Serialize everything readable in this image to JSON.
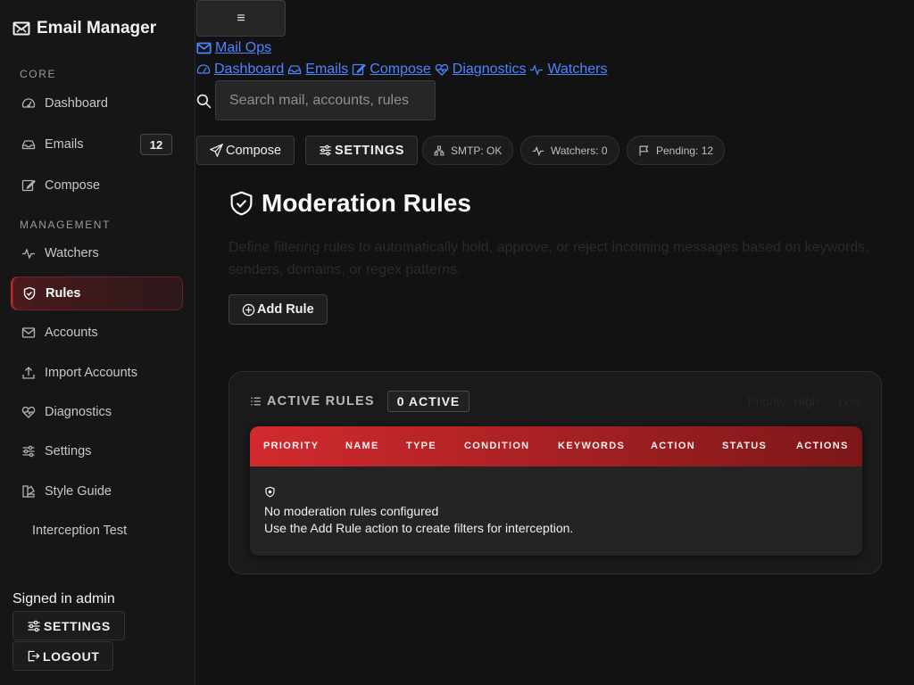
{
  "sidebar": {
    "brand": "Email Manager",
    "sections": {
      "core": "CORE",
      "management": "MANAGEMENT"
    },
    "items": [
      {
        "label": "Dashboard",
        "icon": "gauge-icon"
      },
      {
        "label": "Emails",
        "icon": "inbox-icon",
        "badge": "12"
      },
      {
        "label": "Compose",
        "icon": "pencil-square-icon"
      },
      {
        "label": "Watchers",
        "icon": "activity-icon"
      },
      {
        "label": "Rules",
        "icon": "shield-check-icon",
        "active": true
      },
      {
        "label": "Accounts",
        "icon": "envelope-paper-icon"
      },
      {
        "label": "Import Accounts",
        "icon": "upload-icon"
      },
      {
        "label": "Diagnostics",
        "icon": "heart-pulse-icon"
      },
      {
        "label": "Settings",
        "icon": "sliders-icon"
      },
      {
        "label": "Style Guide",
        "icon": "palette-icon"
      },
      {
        "label": "Interception Test"
      }
    ],
    "signed_in": "Signed in admin",
    "settings_label": "SETTINGS",
    "logout_label": "LOGOUT"
  },
  "topbar": {
    "menu_toggle": "≡",
    "brand_link": "Mail Ops",
    "nav_links": [
      "Dashboard",
      "Emails",
      "Compose",
      "Diagnostics",
      "Watchers"
    ],
    "search_placeholder": "Search mail, accounts, rules",
    "compose_label": "Compose",
    "settings_label": "SETTINGS",
    "status_chips": [
      "SMTP: OK",
      "Watchers: 0",
      "Pending: 12"
    ]
  },
  "main": {
    "title": "Moderation Rules",
    "description": "Define filtering rules to automatically hold, approve, or reject incoming messages based on keywords, senders, domains, or regex patterns.",
    "add_rule_label": "Add Rule",
    "card": {
      "heading": "ACTIVE RULES",
      "count_badge": "0 ACTIVE",
      "sort_hint": "Priority: High → Low",
      "columns": [
        "PRIORITY",
        "NAME",
        "TYPE",
        "CONDITION",
        "KEYWORDS",
        "ACTION",
        "STATUS",
        "ACTIONS"
      ],
      "empty_title": "No moderation rules configured",
      "empty_text": "Use the Add Rule action to create filters for interception."
    }
  },
  "colors": {
    "accent": "#d22a2e",
    "link": "#4d84ff",
    "background": "#121212",
    "sidebar": "#161616"
  }
}
